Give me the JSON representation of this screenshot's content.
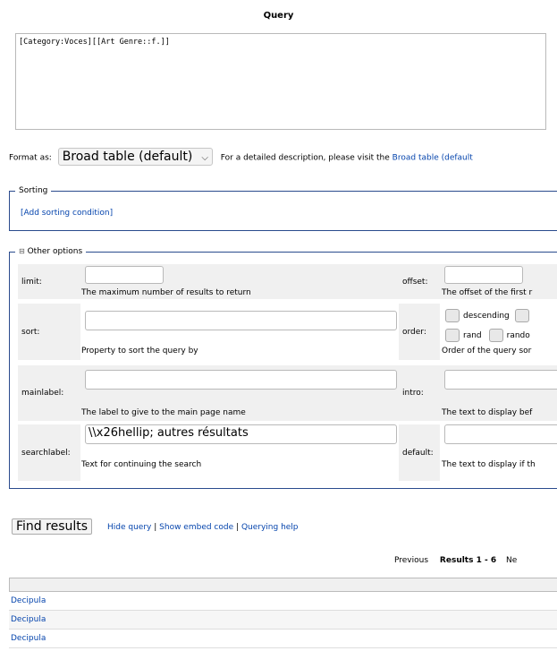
{
  "query": {
    "title": "Query",
    "text": "[Category:Voces][[Art Genre::f.]]"
  },
  "format": {
    "label": "Format as:",
    "selected": "Broad table (default)",
    "desc_prefix": "For a detailed description, please visit the",
    "desc_link": "Broad table (default"
  },
  "sorting": {
    "legend": "Sorting",
    "add_link": "[Add sorting condition]"
  },
  "other": {
    "legend": "Other options",
    "toggle_icon": "collapse-toggle-icon",
    "limit_label": "limit:",
    "limit_help": "The maximum number of results to return",
    "offset_label": "offset:",
    "offset_help": "The offset of the first r",
    "sort_label": "sort:",
    "sort_help": "Property to sort the query by",
    "order_label": "order:",
    "order_desc": "descending",
    "order_rand": "rand",
    "order_rando": "rando",
    "order_help": "Order of the query sor",
    "mainlabel_label": "mainlabel:",
    "mainlabel_help": "The label to give to the main page name",
    "intro_label": "intro:",
    "intro_help": "The text to display bef",
    "searchlabel_label": "searchlabel:",
    "searchlabel_value": "\\\\x26hellip; autres résultats",
    "searchlabel_help": "Text for continuing the search",
    "default_label": "default:",
    "default_help": "The text to display if th"
  },
  "actions": {
    "find": "Find results",
    "hide": "Hide query",
    "embed": "Show embed code",
    "help": "Querying help",
    "sep": "|"
  },
  "nav": {
    "previous": "Previous",
    "results": "Results 1 - 6",
    "next": "Ne"
  },
  "results": {
    "rows": [
      "Decipula",
      "Decipula",
      "Decipula"
    ]
  }
}
